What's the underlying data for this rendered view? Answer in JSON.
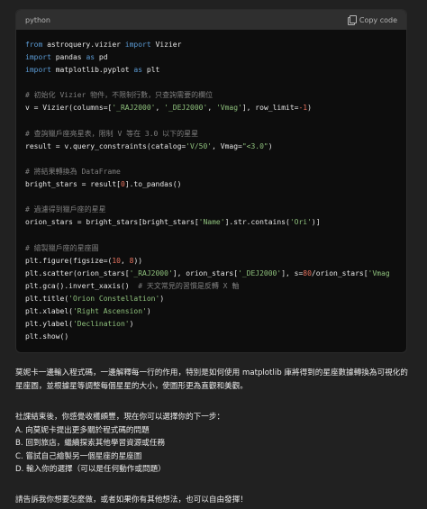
{
  "code_block": {
    "language": "python",
    "copy_label": "Copy code",
    "lines": [
      [
        {
          "t": "from",
          "c": "kw"
        },
        {
          "t": " astroquery.vizier "
        },
        {
          "t": "import",
          "c": "kw"
        },
        {
          "t": " Vizier"
        }
      ],
      [
        {
          "t": "import",
          "c": "kw"
        },
        {
          "t": " pandas "
        },
        {
          "t": "as",
          "c": "kw"
        },
        {
          "t": " pd"
        }
      ],
      [
        {
          "t": "import",
          "c": "kw"
        },
        {
          "t": " matplotlib.pyplot "
        },
        {
          "t": "as",
          "c": "kw"
        },
        {
          "t": " plt"
        }
      ],
      [],
      [
        {
          "t": "# 初始化 Vizier 物件，不限制行數，只查詢需要的欄位",
          "c": "cm"
        }
      ],
      [
        {
          "t": "v = Vizier(columns=["
        },
        {
          "t": "'_RAJ2000'",
          "c": "str"
        },
        {
          "t": ", "
        },
        {
          "t": "'_DEJ2000'",
          "c": "str"
        },
        {
          "t": ", "
        },
        {
          "t": "'Vmag'",
          "c": "str"
        },
        {
          "t": "], row_limit="
        },
        {
          "t": "-1",
          "c": "num"
        },
        {
          "t": ")"
        }
      ],
      [],
      [
        {
          "t": "# 查詢獵戶座亮星表，限制 V 等在 3.0 以下的星星",
          "c": "cm"
        }
      ],
      [
        {
          "t": "result = v.query_constraints(catalog="
        },
        {
          "t": "'V/50'",
          "c": "str"
        },
        {
          "t": ", Vmag="
        },
        {
          "t": "\"<3.0\"",
          "c": "str"
        },
        {
          "t": ")"
        }
      ],
      [],
      [
        {
          "t": "# 將結果轉換為 DataFrame",
          "c": "cm"
        }
      ],
      [
        {
          "t": "bright_stars = result["
        },
        {
          "t": "0",
          "c": "num"
        },
        {
          "t": "].to_pandas()"
        }
      ],
      [],
      [
        {
          "t": "# 過濾得到獵戶座的星星",
          "c": "cm"
        }
      ],
      [
        {
          "t": "orion_stars = bright_stars[bright_stars["
        },
        {
          "t": "'Name'",
          "c": "str"
        },
        {
          "t": "].str.contains("
        },
        {
          "t": "'Ori'",
          "c": "str"
        },
        {
          "t": ")]"
        }
      ],
      [],
      [
        {
          "t": "# 繪製獵戶座的星座圖",
          "c": "cm"
        }
      ],
      [
        {
          "t": "plt.figure(figsize=("
        },
        {
          "t": "10",
          "c": "num"
        },
        {
          "t": ", "
        },
        {
          "t": "8",
          "c": "num"
        },
        {
          "t": "))"
        }
      ],
      [
        {
          "t": "plt.scatter(orion_stars["
        },
        {
          "t": "'_RAJ2000'",
          "c": "str"
        },
        {
          "t": "], orion_stars["
        },
        {
          "t": "'_DEJ2000'",
          "c": "str"
        },
        {
          "t": "], s="
        },
        {
          "t": "80",
          "c": "num"
        },
        {
          "t": "/orion_stars["
        },
        {
          "t": "'Vmag",
          "c": "str"
        }
      ],
      [
        {
          "t": "plt.gca().invert_xaxis()  "
        },
        {
          "t": "# 天文常見的習慣是反轉 X 軸",
          "c": "cm"
        }
      ],
      [
        {
          "t": "plt.title("
        },
        {
          "t": "'Orion Constellation'",
          "c": "str"
        },
        {
          "t": ")"
        }
      ],
      [
        {
          "t": "plt.xlabel("
        },
        {
          "t": "'Right Ascension'",
          "c": "str"
        },
        {
          "t": ")"
        }
      ],
      [
        {
          "t": "plt.ylabel("
        },
        {
          "t": "'Declination'",
          "c": "str"
        },
        {
          "t": ")"
        }
      ],
      [
        {
          "t": "plt.show()"
        }
      ]
    ]
  },
  "explanation": "莫妮卡一邊輸入程式碼，一邊解釋每一行的作用，特別是如何使用 matplotlib 庫將得到的星座數據轉換為可視化的星座圖，並根據星等調整每個星星的大小，使圖形更為直觀和美觀。",
  "choices": {
    "intro": "社課結束後，你感覺收穫頗豐，現在你可以選擇你的下一步：",
    "options": [
      "A. 向莫妮卡提出更多關於程式碼的問題",
      "B. 回到旅店，繼續探索其他學習資源或任務",
      "C. 嘗試自己繪製另一個星座的星座圖",
      "D. 輸入你的選擇（可以是任何動作或問題）"
    ]
  },
  "closing": "請告訴我你想要怎麼做，或者如果你有其他想法，也可以自由發揮！"
}
